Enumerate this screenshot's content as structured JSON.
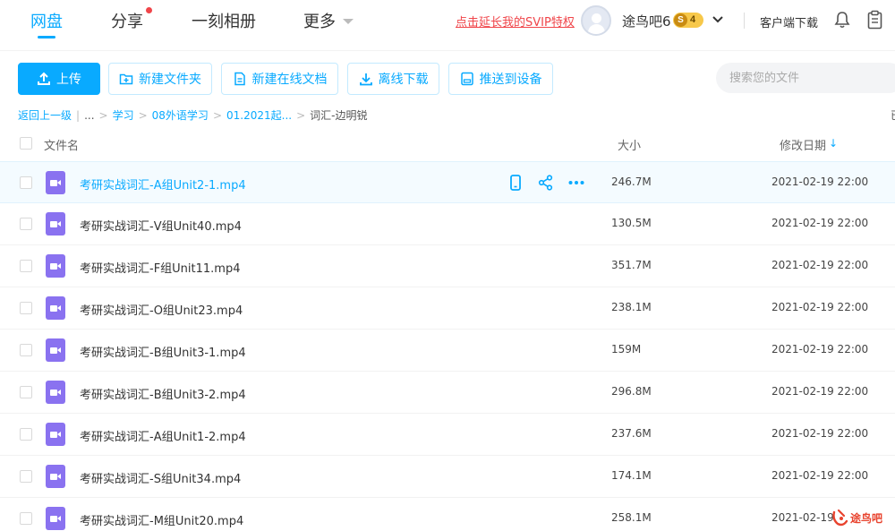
{
  "nav": {
    "tabs": [
      "网盘",
      "分享",
      "一刻相册",
      "更多"
    ],
    "active_tab": "网盘",
    "svip_link": "点击延长我的SVIP特权",
    "username": "途鸟吧6",
    "level_s": "S",
    "level_num": "4",
    "client_download": "客户端下载",
    "accent": "#09AAFF",
    "alert_red": "#f0454a"
  },
  "toolbar": {
    "upload": "上传",
    "new_folder": "新建文件夹",
    "new_doc": "新建在线文档",
    "offline_download": "离线下载",
    "push_device": "推送到设备",
    "search_placeholder": "搜索您的文件"
  },
  "breadcrumb": {
    "back": "返回上一级",
    "ellipsis": "...",
    "items": [
      "学习",
      "08外语学习",
      "01.2021起..."
    ],
    "current": "词汇-边明锐",
    "edge_glyph": "已"
  },
  "list": {
    "col_name": "文件名",
    "col_size": "大小",
    "col_date": "修改日期",
    "sort_arrow": "↓",
    "files": [
      {
        "name": "考研实战词汇-A组Unit2-1.mp4",
        "size": "246.7M",
        "date": "2021-02-19 22:00"
      },
      {
        "name": "考研实战词汇-V组Unit40.mp4",
        "size": "130.5M",
        "date": "2021-02-19 22:00"
      },
      {
        "name": "考研实战词汇-F组Unit11.mp4",
        "size": "351.7M",
        "date": "2021-02-19 22:00"
      },
      {
        "name": "考研实战词汇-O组Unit23.mp4",
        "size": "238.1M",
        "date": "2021-02-19 22:00"
      },
      {
        "name": "考研实战词汇-B组Unit3-1.mp4",
        "size": "159M",
        "date": "2021-02-19 22:00"
      },
      {
        "name": "考研实战词汇-B组Unit3-2.mp4",
        "size": "296.8M",
        "date": "2021-02-19 22:00"
      },
      {
        "name": "考研实战词汇-A组Unit1-2.mp4",
        "size": "237.6M",
        "date": "2021-02-19 22:00"
      },
      {
        "name": "考研实战词汇-S组Unit34.mp4",
        "size": "174.1M",
        "date": "2021-02-19 22:00"
      },
      {
        "name": "考研实战词汇-M组Unit20.mp4",
        "size": "258.1M",
        "date": "2021-02-19"
      }
    ]
  },
  "watermark": {
    "text": "途鸟吧"
  }
}
